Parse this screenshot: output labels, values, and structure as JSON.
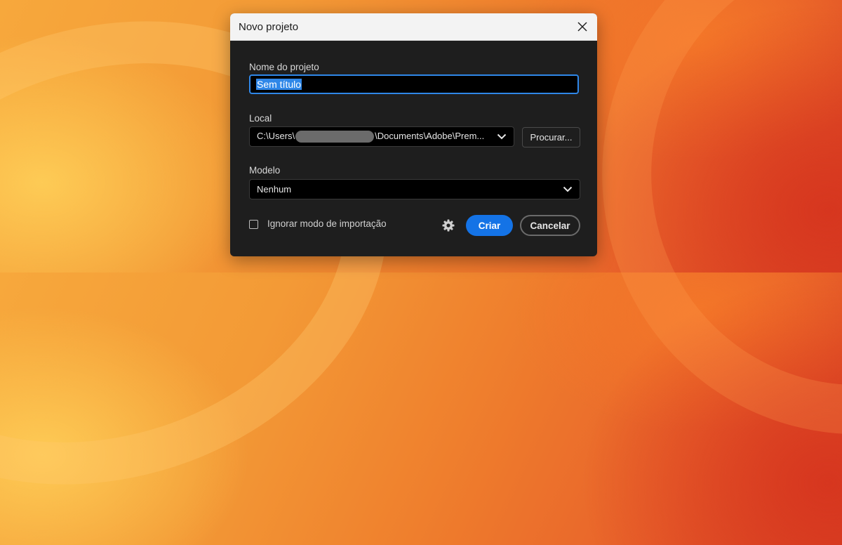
{
  "dialog": {
    "title": "Novo projeto",
    "close_icon": "close-icon"
  },
  "project_name": {
    "label": "Nome do projeto",
    "value": "Sem título"
  },
  "location": {
    "label": "Local",
    "path_prefix": "C:\\Users\\",
    "path_suffix": "\\Documents\\Adobe\\Prem...",
    "browse_label": "Procurar...",
    "dropdown_icon": "chevron-down-icon"
  },
  "template": {
    "label": "Modelo",
    "value": "Nenhum",
    "dropdown_icon": "chevron-down-icon"
  },
  "footer": {
    "ignore_import_label": "Ignorar modo de importação",
    "ignore_import_checked": false,
    "settings_icon": "gear-icon",
    "create_label": "Criar",
    "cancel_label": "Cancelar"
  },
  "colors": {
    "accent": "#1473e6",
    "selection": "#2f87e8",
    "dialog_bg": "#1e1e1e"
  }
}
